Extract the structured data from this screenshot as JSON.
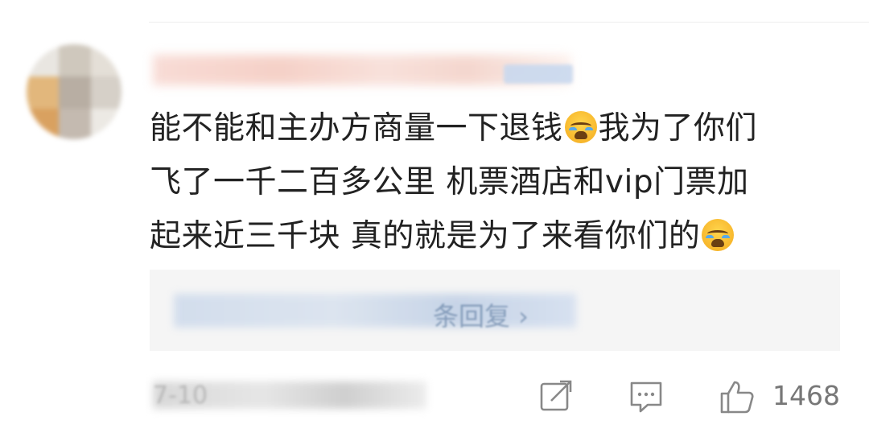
{
  "user": {
    "name": "",
    "badge": ""
  },
  "comment": {
    "lines": [
      "能不能和主办方商量一下退钱",
      "我为了你们",
      "飞了一千二百多公里 机票酒店和vip门票加",
      "起来近三千块 真的就是为了来看你们的"
    ],
    "emoji": "crying-face-emoji"
  },
  "replies": {
    "label": "条回复 ›"
  },
  "footer": {
    "time": "7-10",
    "like_count": "1468"
  },
  "colors": {
    "text": "#222222",
    "reply_bg": "#f5f5f5",
    "icon": "#888888"
  }
}
